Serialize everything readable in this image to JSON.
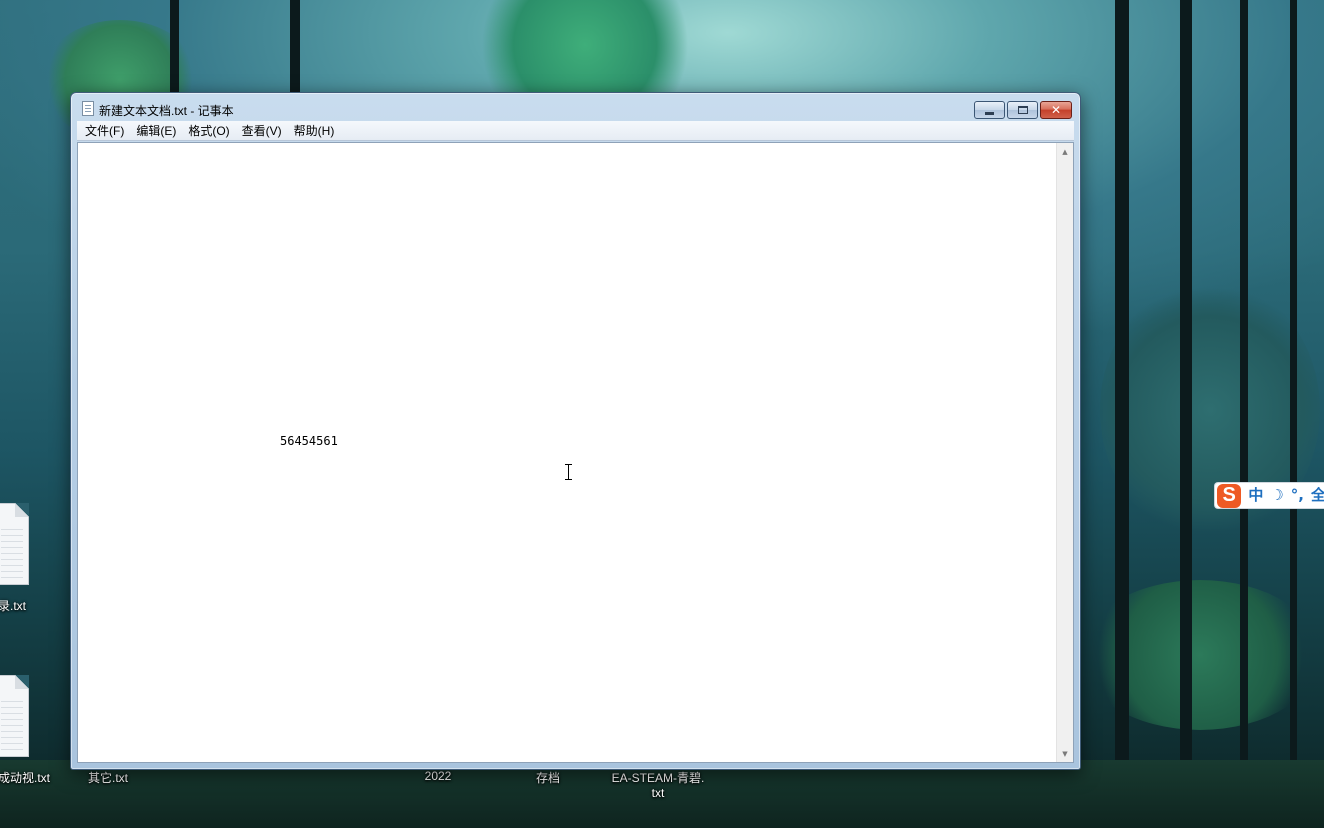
{
  "window": {
    "title": "新建文本文档.txt - 记事本",
    "controls": {
      "minimize": "minimize",
      "maximize": "maximize",
      "close": "✕"
    }
  },
  "menu": [
    {
      "label": "文件(F)"
    },
    {
      "label": "编辑(E)"
    },
    {
      "label": "格式(O)"
    },
    {
      "label": "查看(V)"
    },
    {
      "label": "帮助(H)"
    }
  ],
  "editor": {
    "content": "56454561"
  },
  "desktop_icons": [
    {
      "label": "录.txt",
      "icon": "text-file-icon"
    },
    {
      "label": "成动视.txt",
      "icon": "text-file-icon"
    },
    {
      "label": "其它.txt"
    },
    {
      "label": "2022"
    },
    {
      "label": "存档"
    },
    {
      "label": "EA-STEAM-青碧.",
      "label_line2": "txt"
    }
  ],
  "ime": {
    "logo": "S",
    "mode": "中",
    "moon": "☽",
    "punct": "°,",
    "full": "全"
  }
}
